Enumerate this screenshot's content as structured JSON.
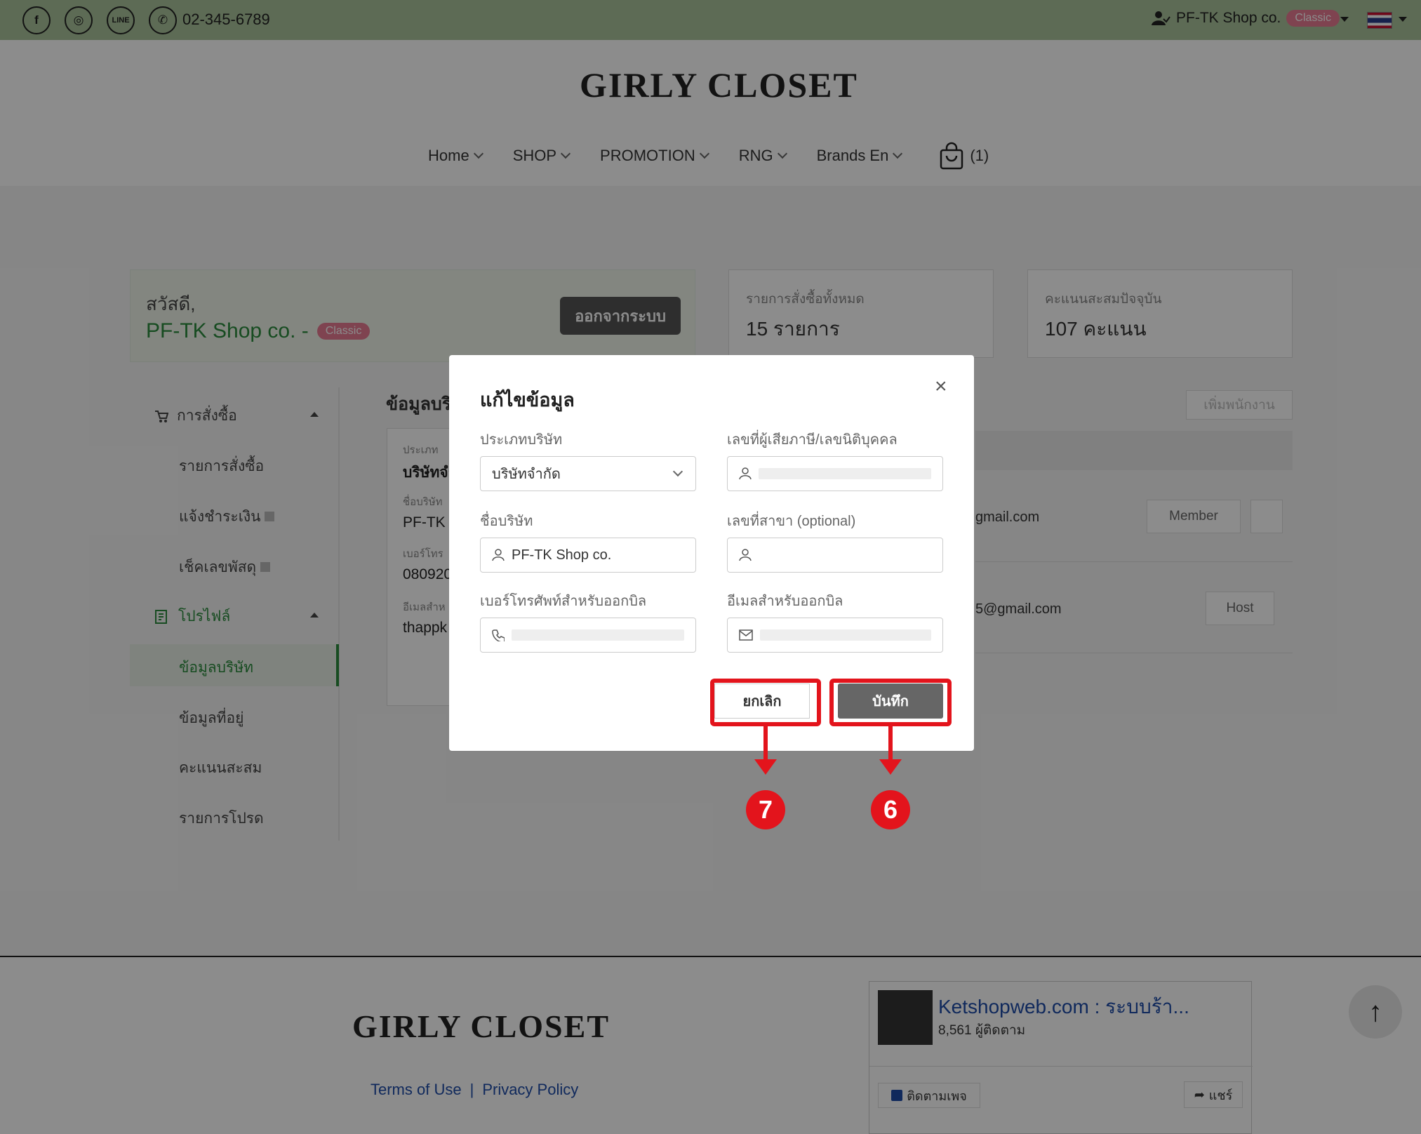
{
  "topbar": {
    "phone": "02-345-6789",
    "social_labels": [
      "f",
      "◎",
      "LINE",
      "✆"
    ],
    "user_name": "PF-TK Shop co.",
    "user_badge": "Classic"
  },
  "header": {
    "logo": "GIRLY CLOSET",
    "nav": [
      "Home",
      "SHOP",
      "PROMOTION",
      "RNG",
      "Brands En"
    ],
    "cart_count": "(1)"
  },
  "greeting": {
    "hello": "สวัสดี,",
    "name": "PF-TK Shop co. -",
    "badge": "Classic",
    "logout": "ออกจากระบบ"
  },
  "stats": [
    {
      "label": "รายการสั่งซื้อทั้งหมด",
      "value": "15 รายการ"
    },
    {
      "label": "คะแนนสะสมปัจจุบัน",
      "value": "107 คะแนน"
    }
  ],
  "sidebar": {
    "orders_section": "การสั่งซื้อ",
    "orders_items": [
      "รายการสั่งซื้อ",
      "แจ้งชำระเงิน",
      "เช็คเลขพัสดุ"
    ],
    "profile_section": "โปรไฟล์",
    "profile_items": [
      "ข้อมูลบริษัท",
      "ข้อมูลที่อยู่",
      "คะแนนสะสม",
      "รายการโปรด"
    ]
  },
  "company_panel": {
    "title": "ข้อมูลบริ",
    "type_label": "ประเภท",
    "type_value": "บริษัทจำ",
    "name_label": "ชื่อบริษัท",
    "name_value": "PF-TK",
    "phone_label": "เบอร์โทร",
    "phone_value": "080920",
    "email_label": "อีเมลสำห",
    "email_value": "thappk"
  },
  "staff_panel": {
    "add_button": "เพิ่มพนักงาน",
    "rows": [
      {
        "email": "gmail.com",
        "role": "Member"
      },
      {
        "email": "5@gmail.com",
        "role": "Host"
      }
    ]
  },
  "modal": {
    "title": "แก้ไขข้อมูล",
    "close": "×",
    "company_type_label": "ประเภทบริษัท",
    "company_type_value": "บริษัทจำกัด",
    "tax_id_label": "เลขที่ผู้เสียภาษี/เลขนิติบุคคล",
    "company_name_label": "ชื่อบริษัท",
    "company_name_value": "PF-TK Shop co.",
    "branch_label": "เลขที่สาขา (optional)",
    "phone_label": "เบอร์โทรศัพท์สำหรับออกบิล",
    "email_label": "อีเมลสำหรับออกบิล",
    "cancel": "ยกเลิก",
    "save": "บันทึก"
  },
  "annotations": {
    "cancel_step": "7",
    "save_step": "6",
    "color": "#e3141c"
  },
  "footer": {
    "logo": "GIRLY CLOSET",
    "terms": "Terms of Use",
    "separator": "|",
    "privacy": "Privacy Policy",
    "fb_page": "Ketshopweb.com : ระบบร้า...",
    "fb_followers": "8,561 ผู้ติดตาม",
    "fb_follow": "ติดตามเพจ",
    "fb_share": "แชร์"
  }
}
